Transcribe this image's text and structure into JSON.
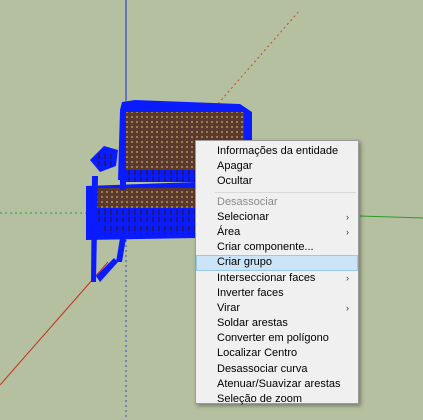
{
  "context_menu": {
    "items": [
      {
        "label": "Informações da entidade",
        "disabled": false,
        "submenu": false,
        "highlighted": false
      },
      {
        "label": "Apagar",
        "disabled": false,
        "submenu": false,
        "highlighted": false
      },
      {
        "label": "Ocultar",
        "disabled": false,
        "submenu": false,
        "highlighted": false
      },
      {
        "label": "Desassociar",
        "disabled": true,
        "submenu": false,
        "highlighted": false
      },
      {
        "label": "Selecionar",
        "disabled": false,
        "submenu": true,
        "highlighted": false
      },
      {
        "label": "Área",
        "disabled": false,
        "submenu": true,
        "highlighted": false
      },
      {
        "label": "Criar componente...",
        "disabled": false,
        "submenu": false,
        "highlighted": false
      },
      {
        "label": "Criar grupo",
        "disabled": false,
        "submenu": false,
        "highlighted": true
      },
      {
        "label": "Interseccionar faces",
        "disabled": false,
        "submenu": true,
        "highlighted": false
      },
      {
        "label": "Inverter faces",
        "disabled": false,
        "submenu": false,
        "highlighted": false
      },
      {
        "label": "Virar",
        "disabled": false,
        "submenu": true,
        "highlighted": false
      },
      {
        "label": "Soldar arestas",
        "disabled": false,
        "submenu": false,
        "highlighted": false
      },
      {
        "label": "Converter em polígono",
        "disabled": false,
        "submenu": false,
        "highlighted": false
      },
      {
        "label": "Localizar Centro",
        "disabled": false,
        "submenu": false,
        "highlighted": false
      },
      {
        "label": "Desassociar curva",
        "disabled": false,
        "submenu": false,
        "highlighted": false
      },
      {
        "label": "Atenuar/Suavizar arestas",
        "disabled": false,
        "submenu": false,
        "highlighted": false
      },
      {
        "label": "Seleção de zoom",
        "disabled": false,
        "submenu": false,
        "highlighted": false
      }
    ],
    "submenu_arrow": "›"
  },
  "colors": {
    "background": "#b5c0a0",
    "selection_blue": "#0a1cff",
    "seat_weave": "#5a3a2c",
    "menu_bg": "#f0f0f0",
    "highlight": "#cce4f7"
  },
  "icons": {
    "submenu": "chevron-right-icon"
  }
}
